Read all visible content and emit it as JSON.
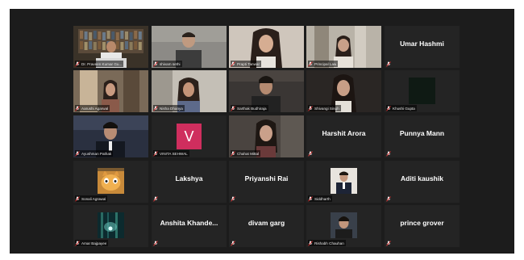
{
  "meeting": {
    "accent_active": "#c9d34a",
    "muted_color": "#e03a3a",
    "tiles": [
      {
        "caption": "Dr. Praveen Kumar Gu...",
        "title": "",
        "kind": "video",
        "scene": "bookshelf",
        "active": true
      },
      {
        "caption": "shivam sethi",
        "title": "",
        "kind": "video",
        "scene": "wall-man"
      },
      {
        "caption": "Prapti Tanwar",
        "title": "",
        "kind": "video",
        "scene": "girl-light"
      },
      {
        "caption": "Principal Law",
        "title": "",
        "kind": "video",
        "scene": "door-woman"
      },
      {
        "caption": "",
        "title": "Umar Hashmi",
        "kind": "name"
      },
      {
        "caption": "Aarushi Agarwal",
        "title": "",
        "kind": "video",
        "scene": "girl-door"
      },
      {
        "caption": "Nisha Dhanya",
        "title": "",
        "kind": "video",
        "scene": "woman-wall"
      },
      {
        "caption": "Sarthak Budhiraja",
        "title": "",
        "kind": "video",
        "scene": "man-dark"
      },
      {
        "caption": "Shivangi Singh",
        "title": "",
        "kind": "video",
        "scene": "girl-dark"
      },
      {
        "caption": "Khushi Gupta",
        "title": "",
        "kind": "avatar-dark"
      },
      {
        "caption": "Ayushman Pathak",
        "title": "",
        "kind": "video",
        "scene": "man-blue"
      },
      {
        "caption": "VINITA SEHWAL",
        "title": "",
        "kind": "avatar-v",
        "letter": "V"
      },
      {
        "caption": "Chahat Mittal",
        "title": "",
        "kind": "video",
        "scene": "girl-indoor"
      },
      {
        "caption": "",
        "title": "Harshit Arora",
        "kind": "name"
      },
      {
        "caption": "",
        "title": "Punnya Mann",
        "kind": "name"
      },
      {
        "caption": "Sonali Agrawal",
        "title": "",
        "kind": "photo",
        "scene": "cat"
      },
      {
        "caption": "",
        "title": "Lakshya",
        "kind": "name"
      },
      {
        "caption": "",
        "title": "Priyanshi Rai",
        "kind": "name"
      },
      {
        "caption": "Siddharth",
        "title": "",
        "kind": "photo",
        "scene": "suit"
      },
      {
        "caption": "",
        "title": "Aditi kaushik",
        "kind": "name"
      },
      {
        "caption": "Amar Bajpayee",
        "title": "",
        "kind": "photo",
        "scene": "forest"
      },
      {
        "caption": "",
        "title": "Anshita  Khande...",
        "kind": "name"
      },
      {
        "caption": "",
        "title": "divam garg",
        "kind": "name"
      },
      {
        "caption": "Rishabh Chauhan",
        "title": "",
        "kind": "photo",
        "scene": "boy"
      },
      {
        "caption": "",
        "title": "prince grover",
        "kind": "name"
      }
    ]
  }
}
